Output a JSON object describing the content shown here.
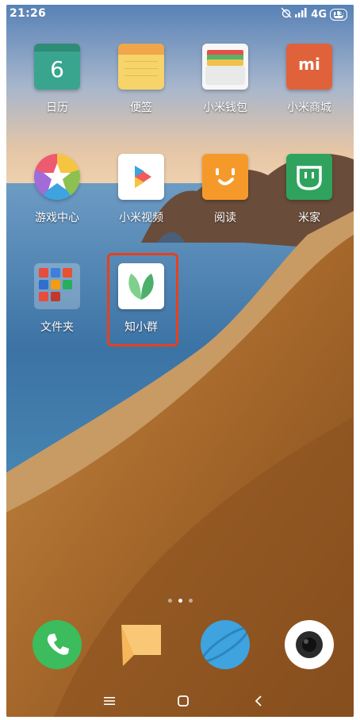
{
  "status_bar": {
    "time": "21:26",
    "network": "4G",
    "battery_level": "13",
    "icons": [
      "alarm-off-icon",
      "signal-icon",
      "battery-icon"
    ]
  },
  "apps": [
    {
      "label": "日历",
      "icon": "calendar-icon",
      "icon_text": "6"
    },
    {
      "label": "便签",
      "icon": "notes-icon"
    },
    {
      "label": "小米钱包",
      "icon": "wallet-icon"
    },
    {
      "label": "小米商城",
      "icon": "mi-store-icon",
      "icon_text": "mi"
    },
    {
      "label": "游戏中心",
      "icon": "game-center-icon"
    },
    {
      "label": "小米视频",
      "icon": "video-play-icon"
    },
    {
      "label": "阅读",
      "icon": "reader-smile-icon"
    },
    {
      "label": "米家",
      "icon": "mijia-icon"
    },
    {
      "label": "文件夹",
      "icon": "folder-icon"
    },
    {
      "label": "知小群",
      "icon": "leaf-icon"
    }
  ],
  "page_indicator": {
    "pages": 3,
    "current": 2
  },
  "dock": [
    {
      "name": "phone",
      "icon": "phone-icon"
    },
    {
      "name": "messages",
      "icon": "message-icon"
    },
    {
      "name": "browser",
      "icon": "browser-planet-icon"
    },
    {
      "name": "camera",
      "icon": "camera-icon"
    }
  ],
  "navigation": [
    "menu-icon",
    "home-icon",
    "back-icon"
  ],
  "colors": {
    "highlight": "#e8401c",
    "calendar": "#3aa58e",
    "notes": "#f4c24c",
    "mi_store": "#e0623b",
    "reader": "#f59a2a",
    "mijia": "#2fa35e",
    "phone": "#3cbc5d",
    "message": "#f6b65a",
    "browser": "#3ea3de"
  }
}
